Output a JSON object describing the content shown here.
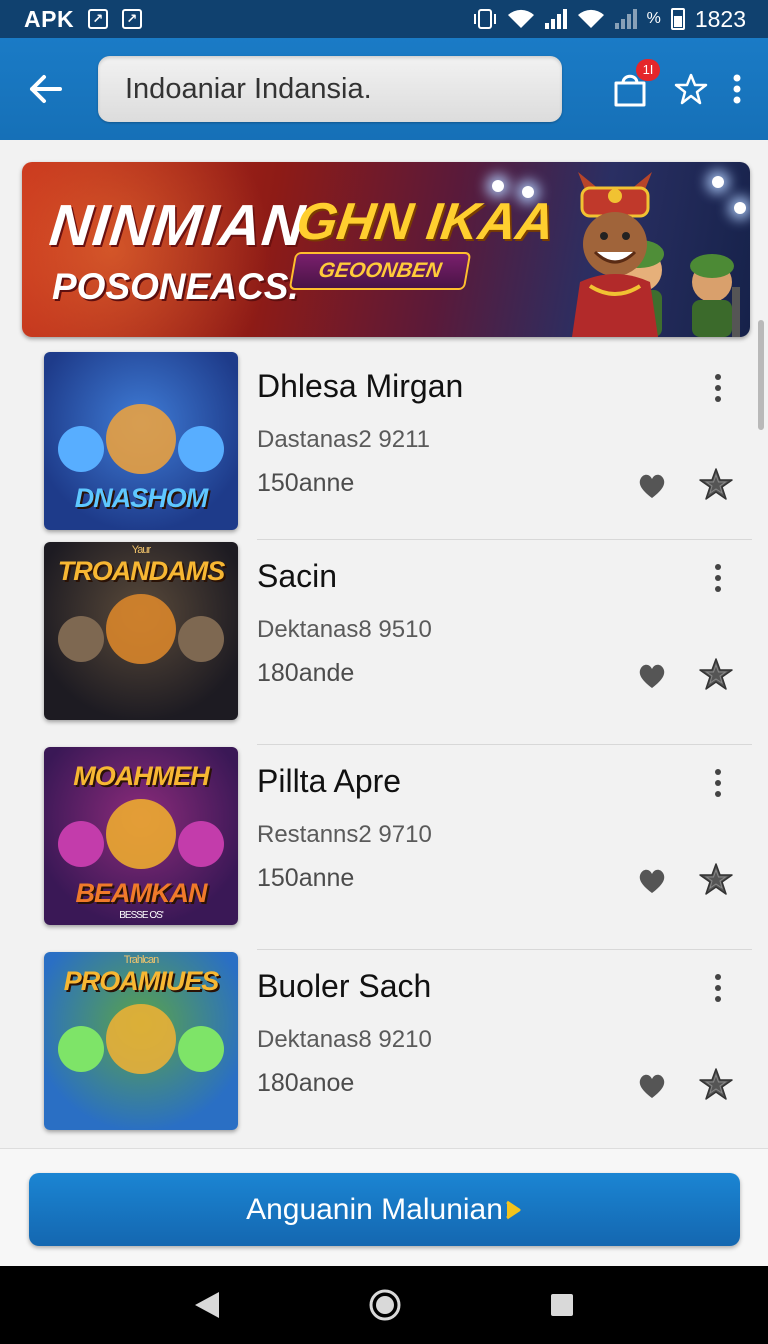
{
  "status_bar": {
    "carrier": "APK",
    "time": "1823"
  },
  "app_bar": {
    "search_value": "Indoaniar Indansia.",
    "notification_count": "1I"
  },
  "banner": {
    "title_left": "NINMIAN",
    "title_right": "GHN IKAA",
    "subtitle": "POSONEACS.",
    "pill_label": "GEOONBEN"
  },
  "items": [
    {
      "title": "Dhlesa Mirgan",
      "subtitle": "Dastanas2 9211",
      "meta": "150anne",
      "thumb_text": "DNASHOM",
      "thumb_colors": [
        "#1e3b8a",
        "#3f7cd6",
        "#f2a33a"
      ]
    },
    {
      "title": "Sacin",
      "subtitle": "Dektanas8 9510",
      "meta": "180ande",
      "thumb_text": "TROANDAMS",
      "thumb_top": "Yaur",
      "thumb_colors": [
        "#1d1b22",
        "#5a4a3a",
        "#e08a2a"
      ]
    },
    {
      "title": "Pillta Apre",
      "subtitle": "Restanns2 9710",
      "meta": "150anne",
      "thumb_text": "MOAHMEH",
      "thumb_bottom": "BEAMKAN",
      "thumb_caption": "BESSE OS'",
      "thumb_colors": [
        "#3a1856",
        "#8b2b7a",
        "#f3b12c"
      ]
    },
    {
      "title": "Buoler Sach",
      "subtitle": "Dektanas8 9210",
      "meta": "180anoe",
      "thumb_text": "PROAMIUES",
      "thumb_top": "Trahlcan",
      "thumb_colors": [
        "#2a6fc4",
        "#5aa34a",
        "#f2b234"
      ]
    }
  ],
  "cta_label": "Anguanin Malunian",
  "colors": {
    "app_bar": "#1670b7",
    "status_bar": "#10416f",
    "badge": "#e5262a",
    "cta": "#1670b7"
  },
  "icons": {
    "back": "arrow-left-icon",
    "bag": "shopping-bag-icon",
    "favorite": "star-outline-icon",
    "more": "more-vertical-icon",
    "heart": "heart-icon",
    "star": "star-icon"
  }
}
